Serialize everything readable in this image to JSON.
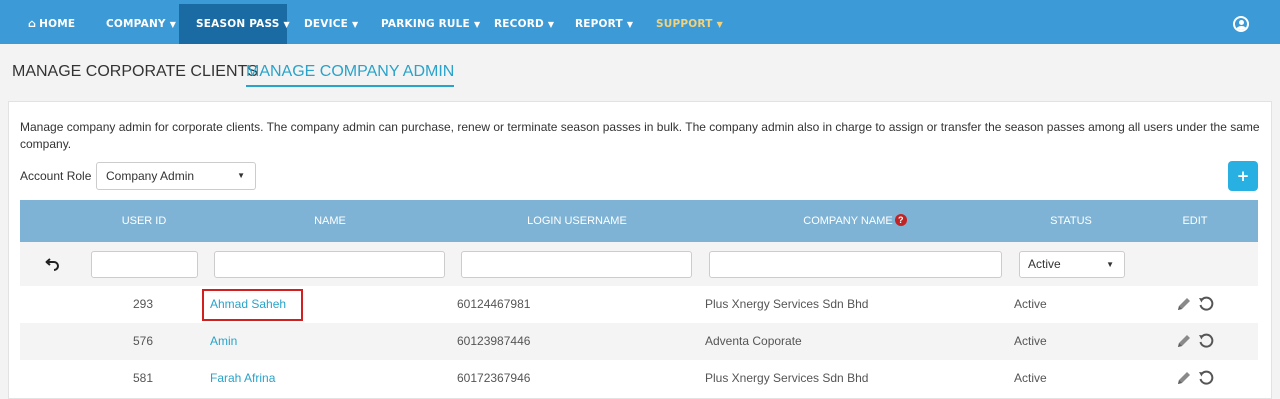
{
  "nav": {
    "items": [
      {
        "label": "HOME",
        "icon": "home-icon"
      },
      {
        "label": "COMPANY"
      },
      {
        "label": "SEASON PASS",
        "active": true
      },
      {
        "label": "DEVICE"
      },
      {
        "label": "PARKING RULE"
      },
      {
        "label": "RECORD"
      },
      {
        "label": "REPORT"
      },
      {
        "label": "SUPPORT",
        "color": "#f3d27a"
      }
    ],
    "user_icon": "user-circle-icon",
    "bar_color": "#3c9ad6",
    "active_color": "#1a6aa3"
  },
  "tabs": {
    "corporate_clients": "MANAGE CORPORATE CLIENTS",
    "company_admin": "MANAGE COMPANY ADMIN"
  },
  "description": "Manage company admin for corporate clients. The company admin can purchase, renew or terminate season passes in bulk. The company admin also in charge to assign or transfer the season passes among all users under the same company.",
  "account_role": {
    "label": "Account Role",
    "selected": "Company Admin"
  },
  "add_button": {
    "label": "+",
    "color": "#29b0e3"
  },
  "table": {
    "headers": {
      "user_id": "USER ID",
      "name": "NAME",
      "login_username": "LOGIN USERNAME",
      "company_name": "COMPANY NAME",
      "status": "STATUS",
      "edit": "EDIT"
    },
    "help_badge": "?",
    "header_color": "#7eb3d5",
    "filters": {
      "status_selected": "Active"
    },
    "rows": [
      {
        "user_id": "293",
        "name": "Ahmad Saheh",
        "login_username": "60124467981",
        "company_name": "Plus Xnergy Services Sdn Bhd",
        "status": "Active"
      },
      {
        "user_id": "576",
        "name": "Amin",
        "login_username": "60123987446",
        "company_name": "Adventa Coporate",
        "status": "Active"
      },
      {
        "user_id": "581",
        "name": "Farah Afrina",
        "login_username": "60172367946",
        "company_name": "Plus Xnergy Services Sdn Bhd",
        "status": "Active"
      }
    ]
  }
}
